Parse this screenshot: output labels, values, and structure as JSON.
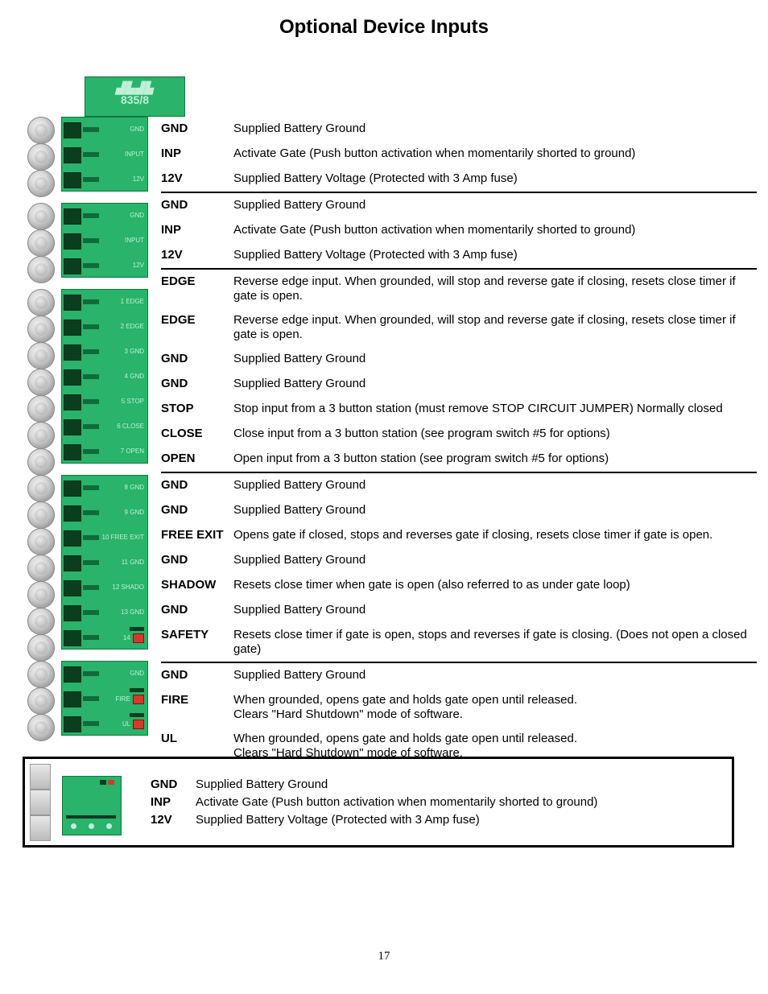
{
  "title": "Optional Device Inputs",
  "pcb_header_line1": "835/8",
  "page_number": "17",
  "groups": [
    {
      "rows": [
        {
          "pin": "GND",
          "label": "GND",
          "desc": "Supplied Battery Ground"
        },
        {
          "pin": "INPUT",
          "label": "INP",
          "desc": "Activate Gate (Push button activation when momentarily shorted to ground)"
        },
        {
          "pin": "12V",
          "label": "12V",
          "desc": "Supplied Battery Voltage (Protected with 3 Amp fuse)"
        }
      ]
    },
    {
      "rows": [
        {
          "pin": "GND",
          "label": "GND",
          "desc": "Supplied Battery Ground"
        },
        {
          "pin": "INPUT",
          "label": "INP",
          "desc": "Activate Gate (Push button activation when momentarily shorted to ground)"
        },
        {
          "pin": "12V",
          "label": "12V",
          "desc": "Supplied Battery Voltage (Protected with 3 Amp fuse)"
        }
      ]
    },
    {
      "rows": [
        {
          "pin": "1  EDGE",
          "label": "EDGE",
          "desc": "Reverse edge input. When grounded, will stop and reverse gate if closing, resets close timer if gate is open."
        },
        {
          "pin": "2  EDGE",
          "label": "EDGE",
          "desc": "Reverse edge input. When grounded, will stop and reverse gate if closing, resets close timer if gate is open."
        },
        {
          "pin": "3  GND",
          "label": "GND",
          "desc": "Supplied Battery Ground"
        },
        {
          "pin": "4  GND",
          "label": "GND",
          "desc": "Supplied Battery Ground"
        },
        {
          "pin": "5  STOP",
          "label": "STOP",
          "desc": "Stop input from a 3 button station (must remove STOP CIRCUIT JUMPER) Normally closed"
        },
        {
          "pin": "6  CLOSE",
          "label": "CLOSE",
          "desc": "Close input from a 3 button station (see program switch #5 for options)"
        },
        {
          "pin": "7  OPEN",
          "label": "OPEN",
          "desc": "Open input from a 3 button station (see program switch #5 for options)"
        }
      ]
    },
    {
      "rows": [
        {
          "pin": "8  GND",
          "label": "GND",
          "desc": "Supplied Battery Ground"
        },
        {
          "pin": "9  GND",
          "label": "GND",
          "desc": "Supplied Battery Ground"
        },
        {
          "pin": "10 FREE EXIT",
          "label": "FREE EXIT",
          "desc": "Opens gate if closed, stops and reverses gate if closing, resets close timer if gate is open."
        },
        {
          "pin": "11 GND",
          "label": "GND",
          "desc": "Supplied Battery Ground"
        },
        {
          "pin": "12 SHADO",
          "label": "SHADOW",
          "desc": "Resets close timer when gate is open (also referred to as under gate loop)"
        },
        {
          "pin": "13 GND",
          "label": "GND",
          "desc": "Supplied Battery Ground"
        },
        {
          "pin": "14",
          "label": "SAFETY",
          "desc": "Resets close timer if gate is open, stops and reverses if gate is closing. (Does not open a closed gate)",
          "red": true
        }
      ]
    },
    {
      "rows": [
        {
          "pin": "GND",
          "label": "GND",
          "desc": "Supplied Battery Ground"
        },
        {
          "pin": "FIRE",
          "label": "FIRE",
          "desc": "When grounded, opens gate and holds gate open until released.\nClears \"Hard Shutdown\" mode of  software.",
          "red": true
        },
        {
          "pin": "UL",
          "label": "UL",
          "desc": "When grounded, opens gate and holds gate open until released.\nClears \"Hard Shutdown\" mode of  software.",
          "red": true
        }
      ],
      "vertical": true
    }
  ],
  "bottom": [
    {
      "label": "GND",
      "desc": "Supplied Battery Ground"
    },
    {
      "label": "INP",
      "desc": "Activate Gate (Push button activation when momentarily shorted to ground)"
    },
    {
      "label": "12V",
      "desc": "Supplied Battery Voltage (Protected with 3 Amp fuse)"
    }
  ]
}
